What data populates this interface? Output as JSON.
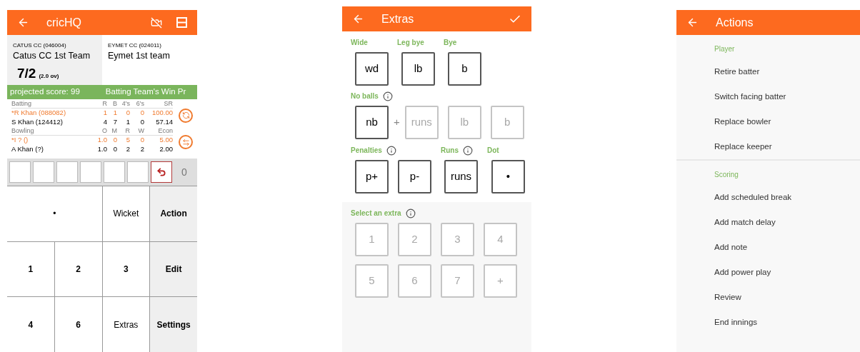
{
  "scoring": {
    "title": "cricHQ",
    "teams": [
      {
        "code": "CATUS CC (046004)",
        "name": "Catus CC 1st Team",
        "score": "7/2",
        "overs": "(2.0 ov)",
        "selected": true
      },
      {
        "code": "EYMET CC (024011)",
        "name": "Eymet 1st team",
        "selected": false
      }
    ],
    "ticker": [
      "projected score: 99",
      "Batting Team's Win Pr"
    ],
    "tables": [
      {
        "columns": [
          "Batting",
          "R",
          "B",
          "4's",
          "6's",
          "SR"
        ],
        "rows": [
          {
            "cells": [
              "*R Khan (088082)",
              "1",
              "1",
              "0",
              "0",
              "100.00"
            ],
            "current": true
          },
          {
            "cells": [
              "S Khan (124412)",
              "4",
              "7",
              "1",
              "0",
              "57.14"
            ],
            "current": false
          }
        ]
      },
      {
        "columns": [
          "Bowling",
          "O",
          "M",
          "R",
          "W",
          "Econ"
        ],
        "rows": [
          {
            "cells": [
              "*I ? ()",
              "1.0",
              "0",
              "5",
              "0",
              "5.00"
            ],
            "current": true
          },
          {
            "cells": [
              "A Khan (?)",
              "1.0",
              "0",
              "2",
              "2",
              "2.00"
            ],
            "current": false
          }
        ]
      }
    ],
    "ball_count": "0",
    "keys": [
      {
        "label": "•",
        "kind": "event",
        "wide": true
      },
      {
        "label": "Wicket",
        "kind": "event",
        "wide": false
      },
      {
        "label": "Action",
        "kind": "menu",
        "wide": false
      },
      {
        "label": "1",
        "kind": "run",
        "wide": false
      },
      {
        "label": "2",
        "kind": "run",
        "wide": false
      },
      {
        "label": "3",
        "kind": "run",
        "wide": false
      },
      {
        "label": "Edit",
        "kind": "menu",
        "wide": false
      },
      {
        "label": "4",
        "kind": "run",
        "wide": false
      },
      {
        "label": "6",
        "kind": "run",
        "wide": false
      },
      {
        "label": "Extras",
        "kind": "event",
        "wide": false
      },
      {
        "label": "Settings",
        "kind": "menu",
        "wide": false
      }
    ]
  },
  "extras": {
    "title": "Extras",
    "top_groups": [
      {
        "label": "Wide",
        "button": "wd"
      },
      {
        "label": "Leg bye",
        "button": "lb"
      },
      {
        "label": "Bye",
        "button": "b"
      }
    ],
    "no_balls": {
      "label": "No balls",
      "button": "nb",
      "plus": "+",
      "options": [
        {
          "label": "runs",
          "disabled": true
        },
        {
          "label": "lb",
          "disabled": true
        },
        {
          "label": "b",
          "disabled": true
        }
      ]
    },
    "penalties": {
      "label": "Penalties",
      "buttons": [
        {
          "label": "p+",
          "disabled": false
        },
        {
          "label": "p-",
          "disabled": false
        }
      ]
    },
    "runs": {
      "label": "Runs",
      "button": "runs"
    },
    "dot": {
      "label": "Dot",
      "button": "•"
    },
    "select": {
      "label": "Select an extra",
      "values": [
        {
          "label": "1",
          "disabled": true
        },
        {
          "label": "2",
          "disabled": true
        },
        {
          "label": "3",
          "disabled": true
        },
        {
          "label": "4",
          "disabled": true
        },
        {
          "label": "5",
          "disabled": true
        },
        {
          "label": "6",
          "disabled": true
        },
        {
          "label": "7",
          "disabled": true
        },
        {
          "label": "+",
          "disabled": true
        }
      ]
    }
  },
  "actions": {
    "title": "Actions",
    "sections": [
      {
        "heading": "Player",
        "items": [
          "Retire batter",
          "Switch facing batter",
          "Replace bowler",
          "Replace keeper"
        ]
      },
      {
        "heading": "Scoring",
        "items": [
          "Add scheduled break",
          "Add match delay",
          "Add note",
          "Add power play",
          "Review",
          "End innings"
        ]
      }
    ]
  }
}
